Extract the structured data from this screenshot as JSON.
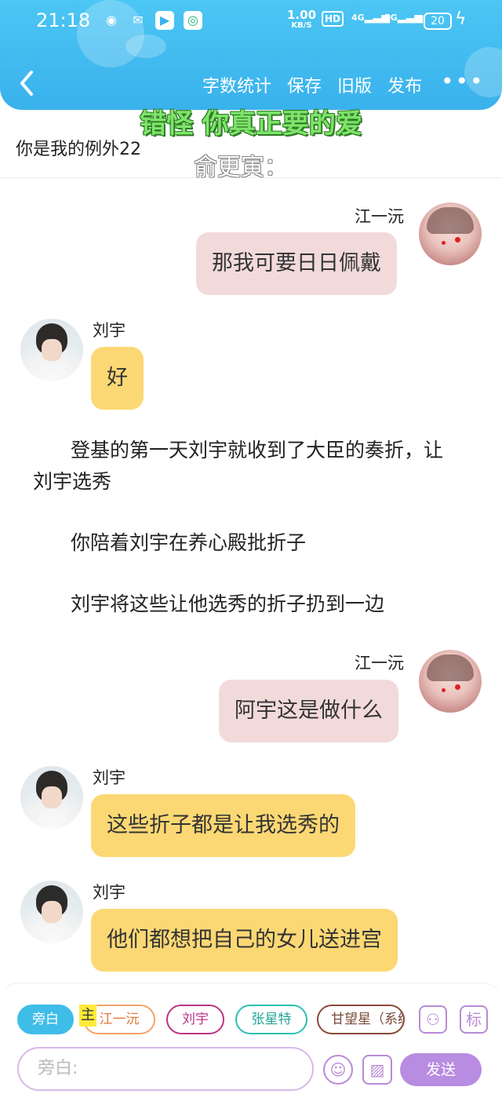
{
  "status_bar": {
    "time": "21:18",
    "net_speed_value": "1.00",
    "net_speed_unit": "KB/S",
    "hd": "HD",
    "signal_1": "4G",
    "signal_2": "5G",
    "battery": "20"
  },
  "header": {
    "nav": [
      "字数统计",
      "保存",
      "旧版",
      "发布"
    ],
    "more": "•••"
  },
  "overlay": {
    "subtitle_main": "错怪 你真正要的爱",
    "subtitle_sub": "俞更寅："
  },
  "story_title": "你是我的例外22",
  "messages": [
    {
      "speaker": "江一沅",
      "text": "那我可要日日佩戴"
    },
    {
      "speaker": "刘宇",
      "text": "好"
    },
    {
      "speaker": "江一沅",
      "text": "阿宇这是做什么"
    },
    {
      "speaker": "刘宇",
      "text": "这些折子都是让我选秀的"
    },
    {
      "speaker": "刘宇",
      "text": "他们都想把自己的女儿送进宫"
    }
  ],
  "narrations": [
    "登基的第一天刘宇就收到了大臣的奏折，让刘宇选秀",
    "你陪着刘宇在养心殿批折子",
    "刘宇将这些让他选秀的折子扔到一边"
  ],
  "composer": {
    "characters": [
      "旁白",
      "江一沅",
      "刘宇",
      "张星特",
      "甘望星（系统）"
    ],
    "main_tag": "主",
    "input_placeholder": "旁白:",
    "send_label": "发送",
    "tool_person_glyph": "⚇",
    "tool_mark_label": "标",
    "emoji_glyph": "☺",
    "image_glyph": "▨"
  },
  "colors": {
    "header_blue": "#3fb8ee",
    "right_bubble": "#f2dadb",
    "left_bubble": "#fcd874",
    "accent_purple": "#b88ce0"
  }
}
